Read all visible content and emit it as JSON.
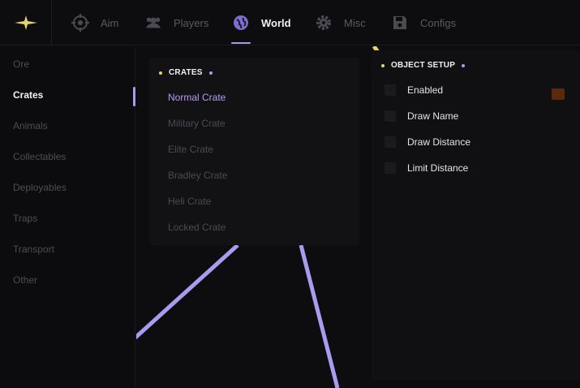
{
  "header": {
    "tabs": [
      {
        "label": "Aim",
        "icon": "crosshair-icon"
      },
      {
        "label": "Players",
        "icon": "users-icon"
      },
      {
        "label": "World",
        "icon": "globe-icon"
      },
      {
        "label": "Misc",
        "icon": "gear-icon"
      },
      {
        "label": "Configs",
        "icon": "save-icon"
      }
    ],
    "active_tab": "World",
    "logo_icon": "sparkle-icon"
  },
  "sidebar": {
    "items": [
      {
        "label": "Ore"
      },
      {
        "label": "Crates"
      },
      {
        "label": "Animals"
      },
      {
        "label": "Collectables"
      },
      {
        "label": "Deployables"
      },
      {
        "label": "Traps"
      },
      {
        "label": "Transport"
      },
      {
        "label": "Other"
      }
    ],
    "active": "Crates"
  },
  "crates_panel": {
    "title": "CRATES",
    "items": [
      {
        "label": "Normal Crate"
      },
      {
        "label": "Military Crate"
      },
      {
        "label": "Elite Crate"
      },
      {
        "label": "Bradley Crate"
      },
      {
        "label": "Heli Crate"
      },
      {
        "label": "Locked Crate"
      }
    ],
    "active": "Normal Crate"
  },
  "setup_panel": {
    "title": "OBJECT SETUP",
    "options": [
      {
        "label": "Enabled",
        "checked": false
      },
      {
        "label": "Draw Name",
        "checked": false
      },
      {
        "label": "Draw Distance",
        "checked": false
      },
      {
        "label": "Limit Distance",
        "checked": false
      }
    ],
    "enabled_color": "#5a2a0a"
  },
  "colors": {
    "accent": "#a89cf0",
    "highlight": "#e6d36a",
    "background": "#0b0b0d"
  }
}
